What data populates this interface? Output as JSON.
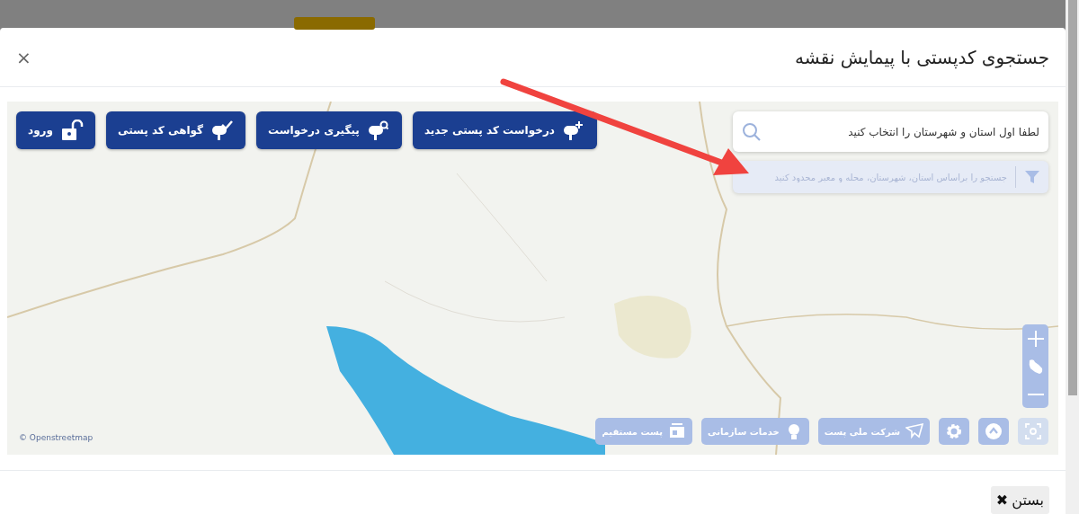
{
  "modal": {
    "title": "جستجوی کدپستی با پیمایش نقشه",
    "close_glyph": "×"
  },
  "map": {
    "kind": "picture",
    "actions": [
      {
        "kind": "new",
        "label": "درخواست کد پستی جدید"
      },
      {
        "kind": "track",
        "label": "پیگیری درخواست"
      },
      {
        "kind": "certificate",
        "label": "گواهی کد پستی"
      },
      {
        "kind": "login",
        "label": "ورود"
      }
    ],
    "search": {
      "placeholder": "لطفا اول استان و شهرستان را انتخاب کنید"
    },
    "filter": {
      "placeholder": "جستجو را براساس استان، شهرستان، محله و معبر محدود کنید",
      "disabled": true
    },
    "toolbar": [
      {
        "kind": "locate",
        "disabled": true
      },
      {
        "kind": "navigate",
        "disabled": false
      },
      {
        "kind": "settings",
        "disabled": false
      },
      {
        "kind": "company",
        "label": "شرکت ملی پست",
        "disabled": false
      },
      {
        "kind": "services",
        "label": "خدمات سازمانی",
        "disabled": false
      },
      {
        "kind": "direct-post",
        "label": "پست مستقیم",
        "disabled": false
      }
    ],
    "attribution": "© Openstreetmap"
  },
  "footer": {
    "close_label": "بستن",
    "close_glyph": "✖"
  }
}
